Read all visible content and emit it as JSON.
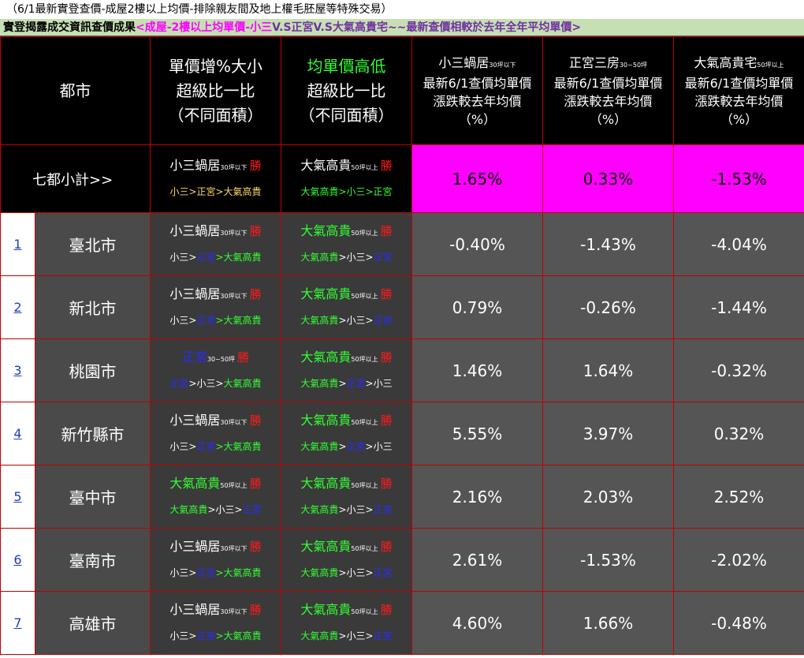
{
  "note": "（6/1最新實登查價-成屋2樓以上均價-排除親友間及地上權毛胚屋等特殊交易）",
  "banner": {
    "part1": "實登揭露成交資訊查價成果",
    "part2": "<成屋-2樓以上均單價-小三",
    "part3": "V.S正宮V.S大氣高貴宅~~最新查價相較於去年全年平均單價>"
  },
  "header": {
    "city": "都市",
    "col1": [
      "單價增%大小",
      "超級比一比",
      "（不同面積）"
    ],
    "col2": [
      "均單價高低",
      "超級比一比",
      "（不同面積）"
    ],
    "col3": {
      "title": "小三蝸居",
      "sub": "30坪以下",
      "lines": [
        "最新6/1查價均單價",
        "漲跌較去年均價",
        "（%）"
      ]
    },
    "col4": {
      "title": "正宮三房",
      "sub": "30~50坪",
      "lines": [
        "最新6/1查價均單價",
        "漲跌較去年均價",
        "（%）"
      ]
    },
    "col5": {
      "title": "大氣高貴宅",
      "sub": "50坪以上",
      "lines": [
        "最新6/1查價均單價",
        "漲跌較去年均價",
        "（%）"
      ]
    }
  },
  "win_label": "勝",
  "summary": {
    "city": "七都小計>>",
    "c1": {
      "name": "小三蝸居",
      "sub": "30坪以下",
      "order": "小三>正宮>大氣高貴"
    },
    "c2": {
      "name": "大氣高貴",
      "sub": "50坪以上",
      "order": "大氣高貴>小三>正宮"
    },
    "p1": "1.65%",
    "p2": "0.33%",
    "p3": "-1.53%"
  },
  "rows": [
    {
      "idx": "1",
      "city": "臺北市",
      "c1": {
        "name": "小三蝸居",
        "sub": "30坪以下",
        "o": [
          [
            "小三>",
            "wht"
          ],
          [
            "正宮",
            "blue"
          ],
          [
            ">大氣高貴",
            "grn"
          ]
        ]
      },
      "c2": {
        "name": "大氣高貴",
        "sub": "50坪以上",
        "o": [
          [
            "大氣高貴",
            "grn"
          ],
          [
            ">小三>",
            "wht"
          ],
          [
            "正宮",
            "blue"
          ]
        ]
      },
      "p1": "-0.40%",
      "p2": "-1.43%",
      "p3": "-4.04%"
    },
    {
      "idx": "2",
      "city": "新北市",
      "c1": {
        "name": "小三蝸居",
        "sub": "30坪以下",
        "o": [
          [
            "小三>",
            "wht"
          ],
          [
            "正宮",
            "blue"
          ],
          [
            ">大氣高貴",
            "grn"
          ]
        ]
      },
      "c2": {
        "name": "大氣高貴",
        "sub": "50坪以上",
        "o": [
          [
            "大氣高貴",
            "grn"
          ],
          [
            ">小三>",
            "wht"
          ],
          [
            "正宮",
            "blue"
          ]
        ]
      },
      "p1": "0.79%",
      "p2": "-0.26%",
      "p3": "-1.44%"
    },
    {
      "idx": "3",
      "city": "桃園市",
      "c1": {
        "name": "正宮",
        "sub": "30~50坪",
        "o": [
          [
            "正宮",
            "blue"
          ],
          [
            ">小三>",
            "wht"
          ],
          [
            "大氣高貴",
            "grn"
          ]
        ]
      },
      "c2": {
        "name": "大氣高貴",
        "sub": "50坪以上",
        "o": [
          [
            "大氣高貴",
            "grn"
          ],
          [
            ">",
            "wht"
          ],
          [
            "正宮",
            "blue"
          ],
          [
            ">小三",
            "wht"
          ]
        ]
      },
      "p1": "1.46%",
      "p2": "1.64%",
      "p3": "-0.32%"
    },
    {
      "idx": "4",
      "city": "新竹縣市",
      "c1": {
        "name": "小三蝸居",
        "sub": "30坪以下",
        "o": [
          [
            "小三>",
            "wht"
          ],
          [
            "正宮",
            "blue"
          ],
          [
            ">大氣高貴",
            "grn"
          ]
        ]
      },
      "c2": {
        "name": "大氣高貴",
        "sub": "50坪以上",
        "o": [
          [
            "大氣高貴",
            "grn"
          ],
          [
            ">",
            "wht"
          ],
          [
            "正宮",
            "blue"
          ],
          [
            ">小三",
            "wht"
          ]
        ]
      },
      "p1": "5.55%",
      "p2": "3.97%",
      "p3": "0.32%"
    },
    {
      "idx": "5",
      "city": "臺中市",
      "c1": {
        "name": "大氣高貴",
        "sub": "50坪以上",
        "o": [
          [
            "大氣高貴",
            "grn"
          ],
          [
            ">小三>",
            "wht"
          ],
          [
            "正宮",
            "blue"
          ]
        ]
      },
      "c2": {
        "name": "大氣高貴",
        "sub": "50坪以上",
        "o": [
          [
            "大氣高貴",
            "grn"
          ],
          [
            ">小三>",
            "wht"
          ],
          [
            "正宮",
            "blue"
          ]
        ]
      },
      "p1": "2.16%",
      "p2": "2.03%",
      "p3": "2.52%"
    },
    {
      "idx": "6",
      "city": "臺南市",
      "c1": {
        "name": "小三蝸居",
        "sub": "30坪以下",
        "o": [
          [
            "小三>",
            "wht"
          ],
          [
            "正宮",
            "blue"
          ],
          [
            ">大氣高貴",
            "grn"
          ]
        ]
      },
      "c2": {
        "name": "大氣高貴",
        "sub": "50坪以上",
        "o": [
          [
            "大氣高貴",
            "grn"
          ],
          [
            ">小三>",
            "wht"
          ],
          [
            "正宮",
            "blue"
          ]
        ]
      },
      "p1": "2.61%",
      "p2": "-1.53%",
      "p3": "-2.02%"
    },
    {
      "idx": "7",
      "city": "高雄市",
      "c1": {
        "name": "小三蝸居",
        "sub": "30坪以下",
        "o": [
          [
            "小三>",
            "wht"
          ],
          [
            "正宮",
            "blue"
          ],
          [
            ">大氣高貴",
            "grn"
          ]
        ]
      },
      "c2": {
        "name": "大氣高貴",
        "sub": "50坪以上",
        "o": [
          [
            "大氣高貴",
            "grn"
          ],
          [
            ">小三>",
            "wht"
          ],
          [
            "正宮",
            "blue"
          ]
        ]
      },
      "p1": "4.60%",
      "p2": "1.66%",
      "p3": "-0.48%"
    }
  ]
}
